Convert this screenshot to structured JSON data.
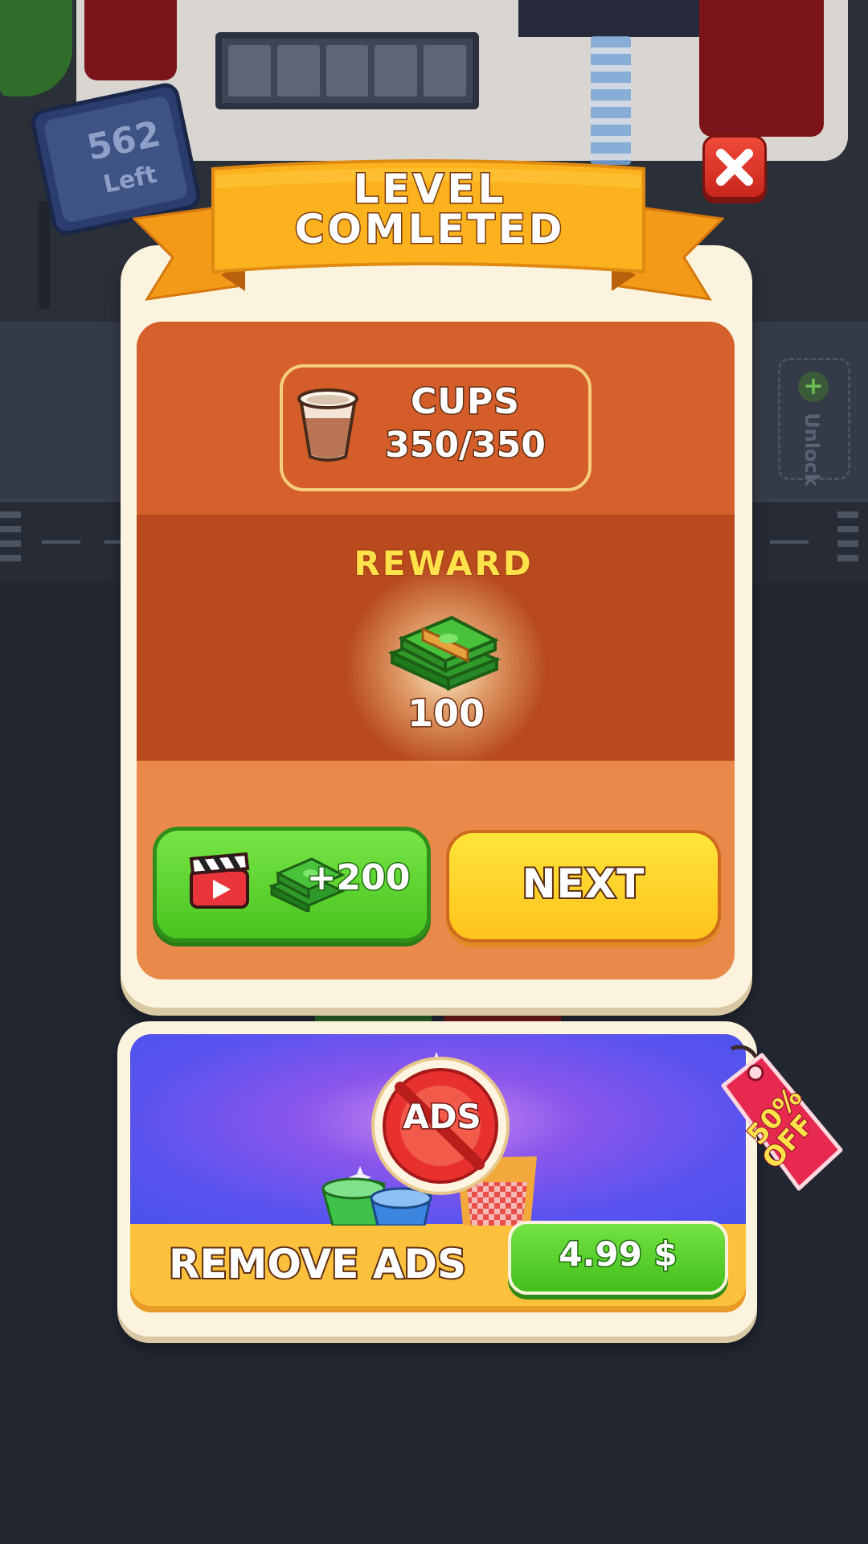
{
  "background": {
    "counter_value": "562",
    "counter_label": "Left",
    "unlock_label": "Unlock"
  },
  "dialog": {
    "title_line1": "LEVEL",
    "title_line2": "COMLETED",
    "cups": {
      "label": "CUPS",
      "value": "350/350"
    },
    "reward": {
      "label": "REWARD",
      "amount": "100"
    },
    "ad_button": {
      "bonus_label": "+200"
    },
    "next_button": {
      "label": "NEXT"
    }
  },
  "offer": {
    "title": "REMOVE ADS",
    "badge_text": "ADS",
    "discount_line1": "50%",
    "discount_line2": "OFF",
    "price_label": "4.99 $"
  },
  "colors": {
    "ribbon": "#f7a21b",
    "panel_orange": "#d6602c",
    "reward_band": "#b84a1e",
    "next_yellow": "#ffd22a",
    "ad_green": "#5ad22c",
    "close_red": "#e0362a",
    "ads_purple": "#5a53ef",
    "sale_tag_red": "#e8294f"
  },
  "icons": [
    "close-icon",
    "cup-icon",
    "money-stack-icon",
    "clapperboard-icon",
    "no-ads-icon",
    "sale-tag-icon"
  ]
}
